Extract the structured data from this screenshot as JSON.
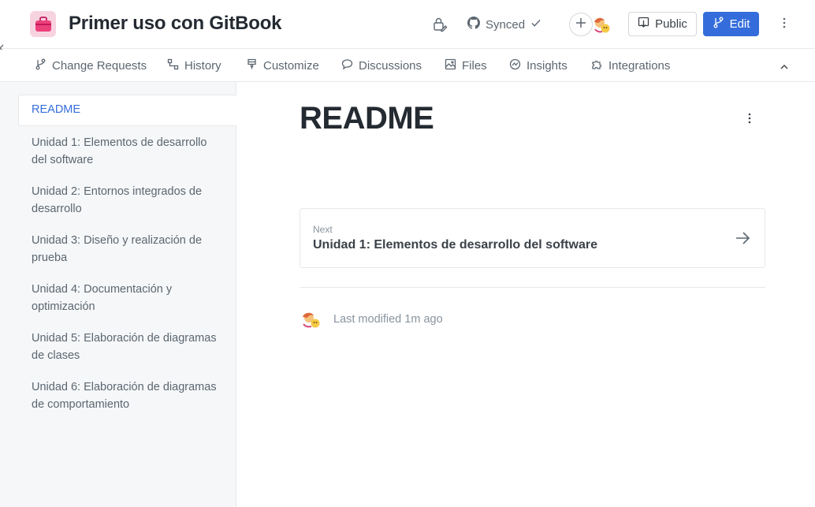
{
  "header": {
    "space_title": "Primer uso con GitBook",
    "space_icon": "briefcase-icon",
    "synced_label": "Synced",
    "public_label": "Public",
    "edit_label": "Edit"
  },
  "tabs": [
    {
      "label": "Change Requests",
      "icon": "branch-icon"
    },
    {
      "label": "History",
      "icon": "history-icon"
    },
    {
      "label": "Customize",
      "icon": "brush-icon"
    },
    {
      "label": "Discussions",
      "icon": "chat-bubble-icon"
    },
    {
      "label": "Files",
      "icon": "image-icon"
    },
    {
      "label": "Insights",
      "icon": "insights-icon"
    },
    {
      "label": "Integrations",
      "icon": "puzzle-icon"
    }
  ],
  "sidebar": {
    "items": [
      {
        "label": "README"
      },
      {
        "label": "Unidad 1: Elementos de desarrollo del software"
      },
      {
        "label": "Unidad 2: Entornos integrados de desarrollo"
      },
      {
        "label": "Unidad 3: Diseño y realización de prueba"
      },
      {
        "label": "Unidad 4: Documentación y optimización"
      },
      {
        "label": "Unidad 5: Elaboración de diagramas de clases"
      },
      {
        "label": "Unidad 6: Elaboración de diagramas de comportamiento"
      }
    ]
  },
  "main": {
    "title": "README",
    "next_label": "Next",
    "next_title": "Unidad 1: Elementos de desarrollo del software",
    "last_modified": "Last modified 1m ago"
  },
  "colors": {
    "accent": "#346ddb",
    "sidebar_bg": "#f5f7f9",
    "title_text": "#242a31",
    "muted_text": "#88949f"
  }
}
